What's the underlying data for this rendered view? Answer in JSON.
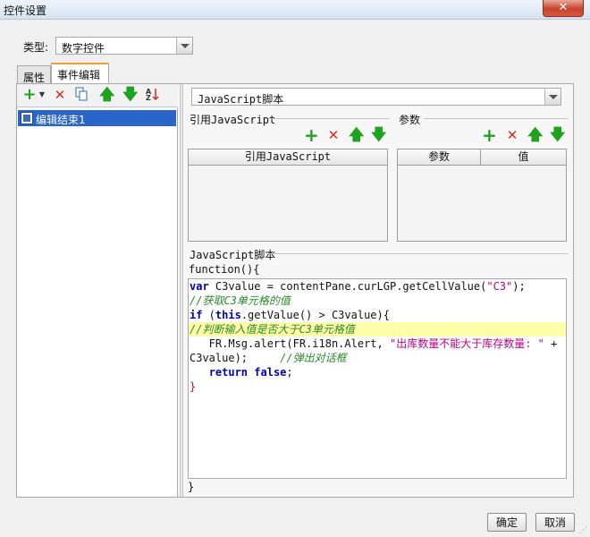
{
  "window": {
    "title": "控件设置",
    "close_glyph": "✕"
  },
  "type_row": {
    "label": "类型:",
    "value": "数字控件"
  },
  "tabs": [
    {
      "label": "属性",
      "active": false
    },
    {
      "label": "事件编辑",
      "active": true
    }
  ],
  "left_toolbar": {
    "icons": [
      "add-dropdown-icon",
      "delete-icon",
      "copy-icon",
      "move-up-icon",
      "move-down-icon",
      "sort-icon"
    ]
  },
  "event_list": [
    {
      "label": "编辑结束1",
      "selected": true,
      "icon": "event-icon"
    }
  ],
  "script_type": {
    "value": "JavaScript脚本"
  },
  "ref_js": {
    "title": "引用JavaScript",
    "column": "引用JavaScript",
    "icons": [
      "add-icon",
      "delete-icon",
      "move-up-icon",
      "move-down-icon"
    ]
  },
  "params": {
    "title": "参数",
    "columns": [
      "参数",
      "值"
    ],
    "icons": [
      "add-icon",
      "delete-icon",
      "move-up-icon",
      "move-down-icon"
    ]
  },
  "script": {
    "title": "JavaScript脚本",
    "header": "function(){",
    "footer": "}",
    "code": {
      "l1_kw": "var",
      "l1_a": " C3value = contentPane.curLGP.getCellValue(",
      "l1_str": "\"C3\"",
      "l1_b": ");",
      "l2_cmt": "//获取C3单元格的值",
      "l3_kw": "if",
      "l3_a": " (",
      "l3_kw2": "this",
      "l3_b": ".getValue() > C3value){",
      "l4_cmt": "//判断输入值是否大于C3单元格值",
      "l5_a": "   FR.Msg.alert(FR.i18n.Alert, ",
      "l5_str": "\"出库数量不能大于库存数量: \"",
      "l5_b": " +",
      "l6_a": "C3value);     ",
      "l6_cmt": "//弹出对话框",
      "l7_indent": "   ",
      "l7_kw": "return",
      "l7_a": " ",
      "l7_kw2": "false",
      "l7_b": ";",
      "l8_brace": "}"
    }
  },
  "buttons": {
    "ok": "确定",
    "cancel": "取消"
  },
  "colors": {
    "selection": "#2a66c9",
    "green_icon": "#1ea31e",
    "red_icon": "#d62b1e",
    "keyword": "#0000b8",
    "string": "#c0008a",
    "comment": "#2a8a2a",
    "highlight": "#ffffaa"
  }
}
